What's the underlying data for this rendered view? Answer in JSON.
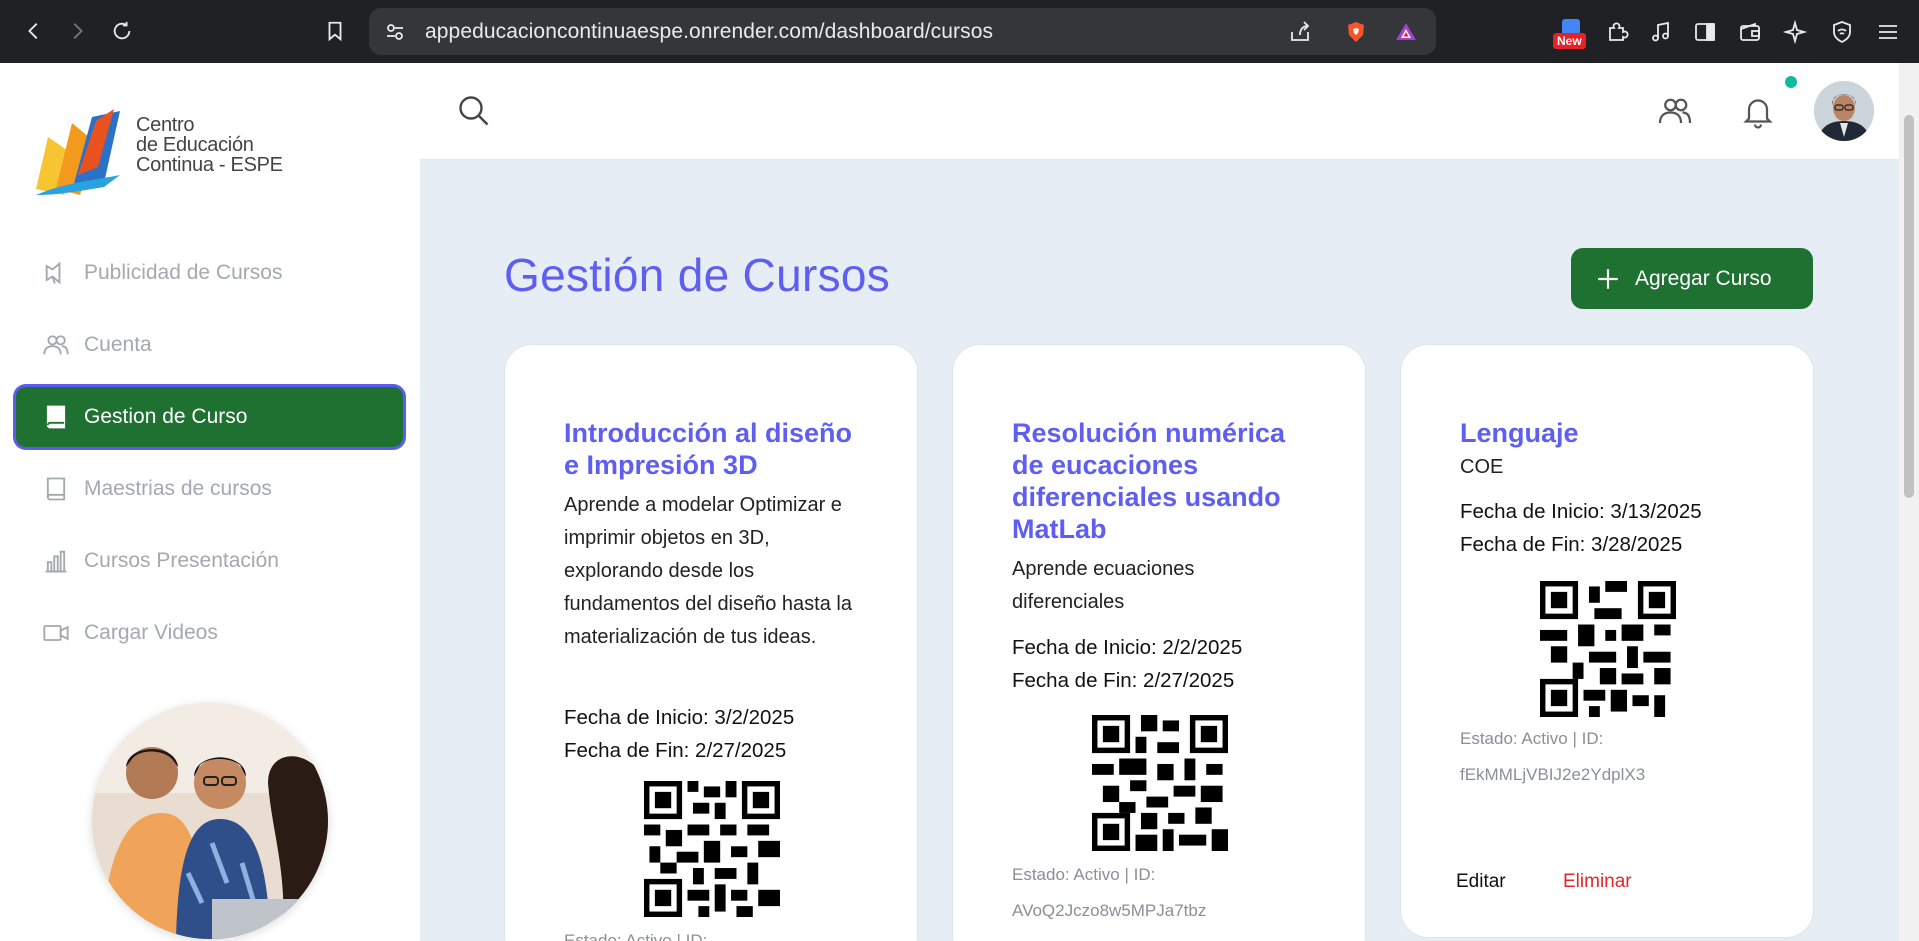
{
  "browser": {
    "url": "appeducacioncontinuaespe.onrender.com/dashboard/cursos",
    "new_badge": "New"
  },
  "sidebar": {
    "logo": {
      "line1": "Centro",
      "line2": "de Educación",
      "line3": "Continua - ESPE"
    },
    "items": [
      {
        "label": "Publicidad de Cursos",
        "icon": "megaphone-icon",
        "active": false
      },
      {
        "label": "Cuenta",
        "icon": "users-icon",
        "active": false
      },
      {
        "label": "Gestion de Curso",
        "icon": "book-icon",
        "active": true
      },
      {
        "label": "Maestrias de cursos",
        "icon": "book-icon",
        "active": false
      },
      {
        "label": "Cursos Presentación",
        "icon": "bar-chart-icon",
        "active": false
      },
      {
        "label": "Cargar Videos",
        "icon": "video-icon",
        "active": false
      }
    ]
  },
  "main": {
    "title": "Gestión de Cursos",
    "add_button": "Agregar Curso",
    "cards": [
      {
        "title": "Introducción al diseño e Impresión 3D",
        "description": "Aprende a modelar Optimizar e imprimir objetos en 3D, explorando desde los fundamentos del diseño hasta la materialización de tus ideas.",
        "start": "Fecha de Inicio: 3/2/2025",
        "end": "Fecha de Fin: 2/27/2025",
        "status": "Estado: Activo | ID:",
        "id": ""
      },
      {
        "title": "Resolución numérica de eucaciones diferenciales usando MatLab",
        "description": "Aprende ecuaciones diferenciales",
        "start": "Fecha de Inicio: 2/2/2025",
        "end": "Fecha de Fin: 2/27/2025",
        "status": "Estado: Activo | ID:",
        "id": "AVoQ2Jczo8w5MPJa7tbz"
      },
      {
        "title": "Lenguaje",
        "description": "COE",
        "start": "Fecha de Inicio: 3/13/2025",
        "end": "Fecha de Fin: 3/28/2025",
        "status": "Estado: Activo | ID:",
        "id": "fEkMMLjVBIJ2e2YdplX3",
        "edit": "Editar",
        "delete": "Eliminar"
      }
    ]
  },
  "colors": {
    "accent": "#5e5ef0",
    "primary_green": "#1e7131",
    "danger": "#e0272b",
    "background": "#e6edf4"
  }
}
